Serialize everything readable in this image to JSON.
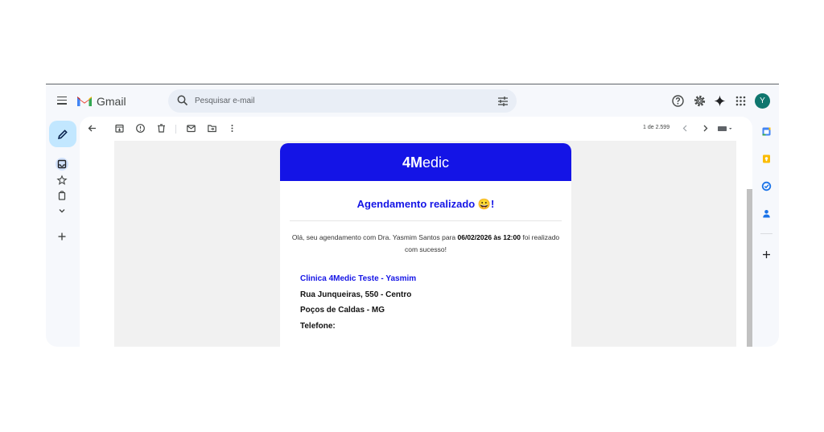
{
  "app": {
    "title": "Gmail"
  },
  "search": {
    "placeholder": "Pesquisar e-mail"
  },
  "user": {
    "avatar_initial": "Y",
    "avatar_color": "#0f766e"
  },
  "toolbar": {
    "message_count": "1 de 2.599"
  },
  "email": {
    "brand_bold": "4M",
    "brand_rest": "edic",
    "header_color": "#1414e6",
    "title": "Agendamento realizado 😀!",
    "msg_before": "Olá, seu agendamento com Dra. Yasmim Santos para ",
    "msg_date": "06/02/2026 às 12:00",
    "msg_after": " foi realizado com sucesso!",
    "clinic_name": "Clinica 4Medic Teste - Yasmim",
    "address_line1": "Rua Junqueiras, 550 - Centro",
    "address_line2": "Poços de Caldas - MG",
    "phone_label": "Telefone:"
  },
  "icons": {
    "sidebar": [
      "compose-icon",
      "inbox-icon",
      "starred-icon",
      "clipboard-icon",
      "chevron-down-icon",
      "plus-icon"
    ],
    "toolbar": [
      "back-arrow-icon",
      "archive-icon",
      "report-spam-icon",
      "delete-icon",
      "mark-unread-icon",
      "move-to-icon",
      "more-vert-icon",
      "chevron-left-icon",
      "chevron-right-icon",
      "keyboard-icon"
    ],
    "right_panel": [
      "calendar-icon",
      "keep-icon",
      "tasks-icon",
      "contacts-icon",
      "add-addon-icon"
    ]
  }
}
